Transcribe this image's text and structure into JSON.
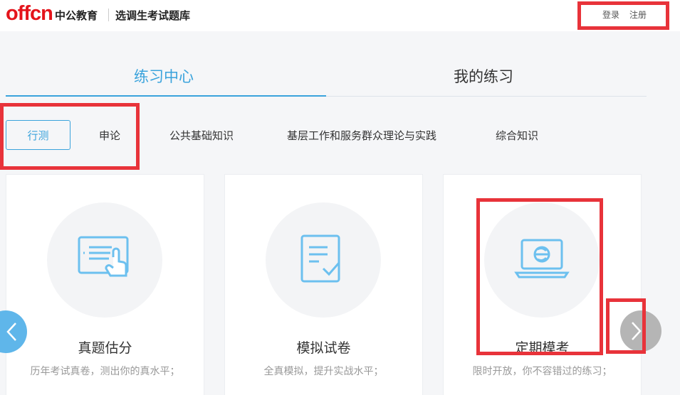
{
  "header": {
    "logo_text": "offcn",
    "brand": "中公教育",
    "site_title": "选调生考试题库",
    "login": "登录",
    "register": "注册"
  },
  "main_tabs": [
    {
      "label": "练习中心",
      "active": true
    },
    {
      "label": "我的练习",
      "active": false
    }
  ],
  "subject_tabs": [
    {
      "label": "行测",
      "active": true
    },
    {
      "label": "申论",
      "active": false
    },
    {
      "label": "公共基础知识",
      "active": false
    },
    {
      "label": "基层工作和服务群众理论与实践",
      "active": false
    },
    {
      "label": "综合知识",
      "active": false
    }
  ],
  "cards": [
    {
      "title": "真题估分",
      "desc": "历年考试真卷，测出你的真水平；",
      "icon": "touch-screen-icon"
    },
    {
      "title": "模拟试卷",
      "desc": "全真模拟，提升实战水平；",
      "icon": "checklist-icon"
    },
    {
      "title": "定期模考",
      "desc": "限时开放，你不容错过的练习；",
      "icon": "laptop-e-icon"
    }
  ],
  "colors": {
    "accent": "#3aa3dc",
    "brand_red": "#e4141b",
    "highlight": "#e8333a",
    "icon_blue": "#6cc0ef"
  }
}
